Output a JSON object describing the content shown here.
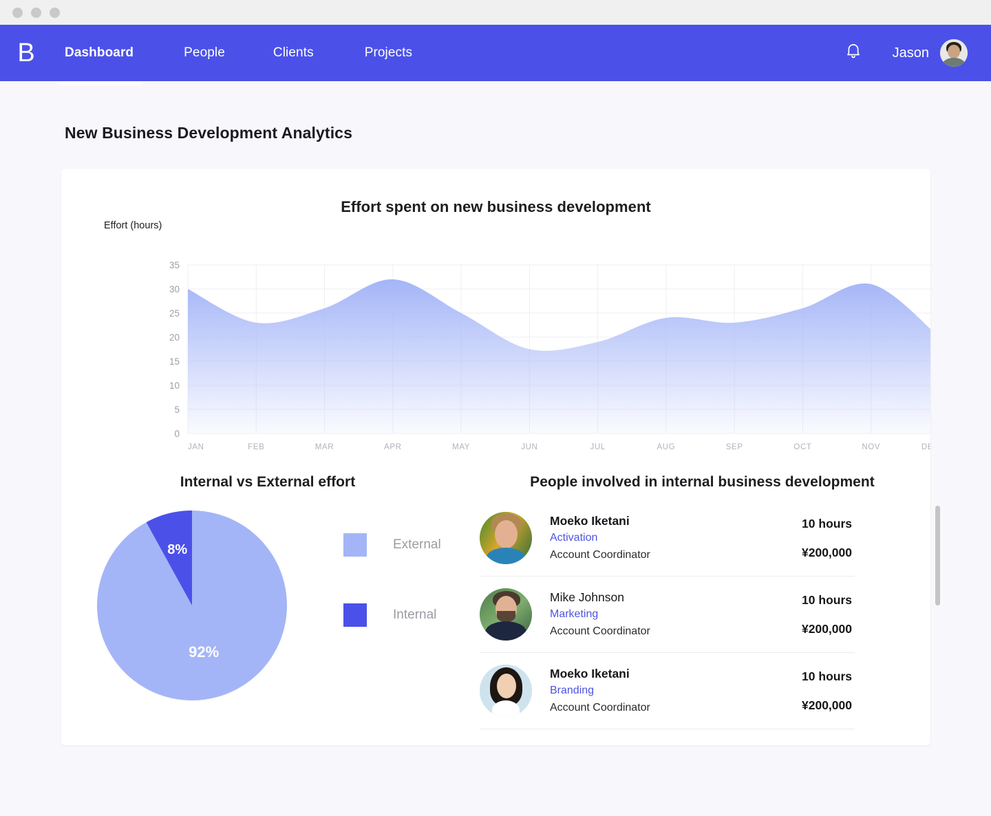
{
  "window": {
    "dots": [
      "close",
      "minimize",
      "maximize"
    ]
  },
  "navbar": {
    "brand": "B",
    "items": [
      {
        "label": "Dashboard",
        "active": true
      },
      {
        "label": "People",
        "active": false
      },
      {
        "label": "Clients",
        "active": false
      },
      {
        "label": "Projects",
        "active": false
      }
    ],
    "bell_icon": "bell-icon",
    "user_name": "Jason",
    "avatar_icon": "user-avatar",
    "background_color": "#4b51e8"
  },
  "page": {
    "title": "New Business Development Analytics",
    "background_color": "#f8f8fc"
  },
  "chart_data": [
    {
      "type": "area",
      "title": "Effort spent on new business development",
      "ylabel": "Effort (hours)",
      "xlabel": "",
      "categories": [
        "JAN",
        "FEB",
        "MAR",
        "APR",
        "MAY",
        "JUN",
        "JUL",
        "AUG",
        "SEP",
        "OCT",
        "NOV",
        "DEC"
      ],
      "values": [
        30,
        23,
        26,
        32,
        25,
        17.5,
        19,
        24,
        23,
        26,
        31,
        20
      ],
      "ylim": [
        0,
        35
      ],
      "yticks": [
        0,
        5,
        10,
        15,
        20,
        25,
        30,
        35
      ],
      "grid": true,
      "legend": "none",
      "series_color": "#a4b5f7"
    },
    {
      "type": "pie",
      "title": "Internal vs External effort",
      "labels": [
        "External",
        "Internal"
      ],
      "values": [
        92,
        8
      ],
      "value_labels": [
        "92%",
        "8%"
      ],
      "colors": [
        "#a4b5f7",
        "#4b51e8"
      ],
      "legend": "right"
    }
  ],
  "people_panel": {
    "title": "People involved in internal business development",
    "rows": [
      {
        "name": "Moeko Iketani",
        "name_bold": true,
        "department": "Activation",
        "role": "Account Coordinator",
        "hours": "10 hours",
        "amount": "¥200,000",
        "avatar": "avatar-moeko-iketani"
      },
      {
        "name": "Mike Johnson",
        "name_bold": false,
        "department": "Marketing",
        "role": "Account Coordinator",
        "hours": "10 hours",
        "amount": "¥200,000",
        "avatar": "avatar-mike-johnson"
      },
      {
        "name": "Moeko Iketani",
        "name_bold": true,
        "department": "Branding",
        "role": "Account Coordinator",
        "hours": "10 hours",
        "amount": "¥200,000",
        "avatar": "avatar-moeko-iketani-2"
      }
    ]
  },
  "colors": {
    "accent": "#4b51e8",
    "area_light": "#a4b5f7",
    "dept_link": "#4d53e0",
    "muted_text": "#9b9ba3"
  }
}
